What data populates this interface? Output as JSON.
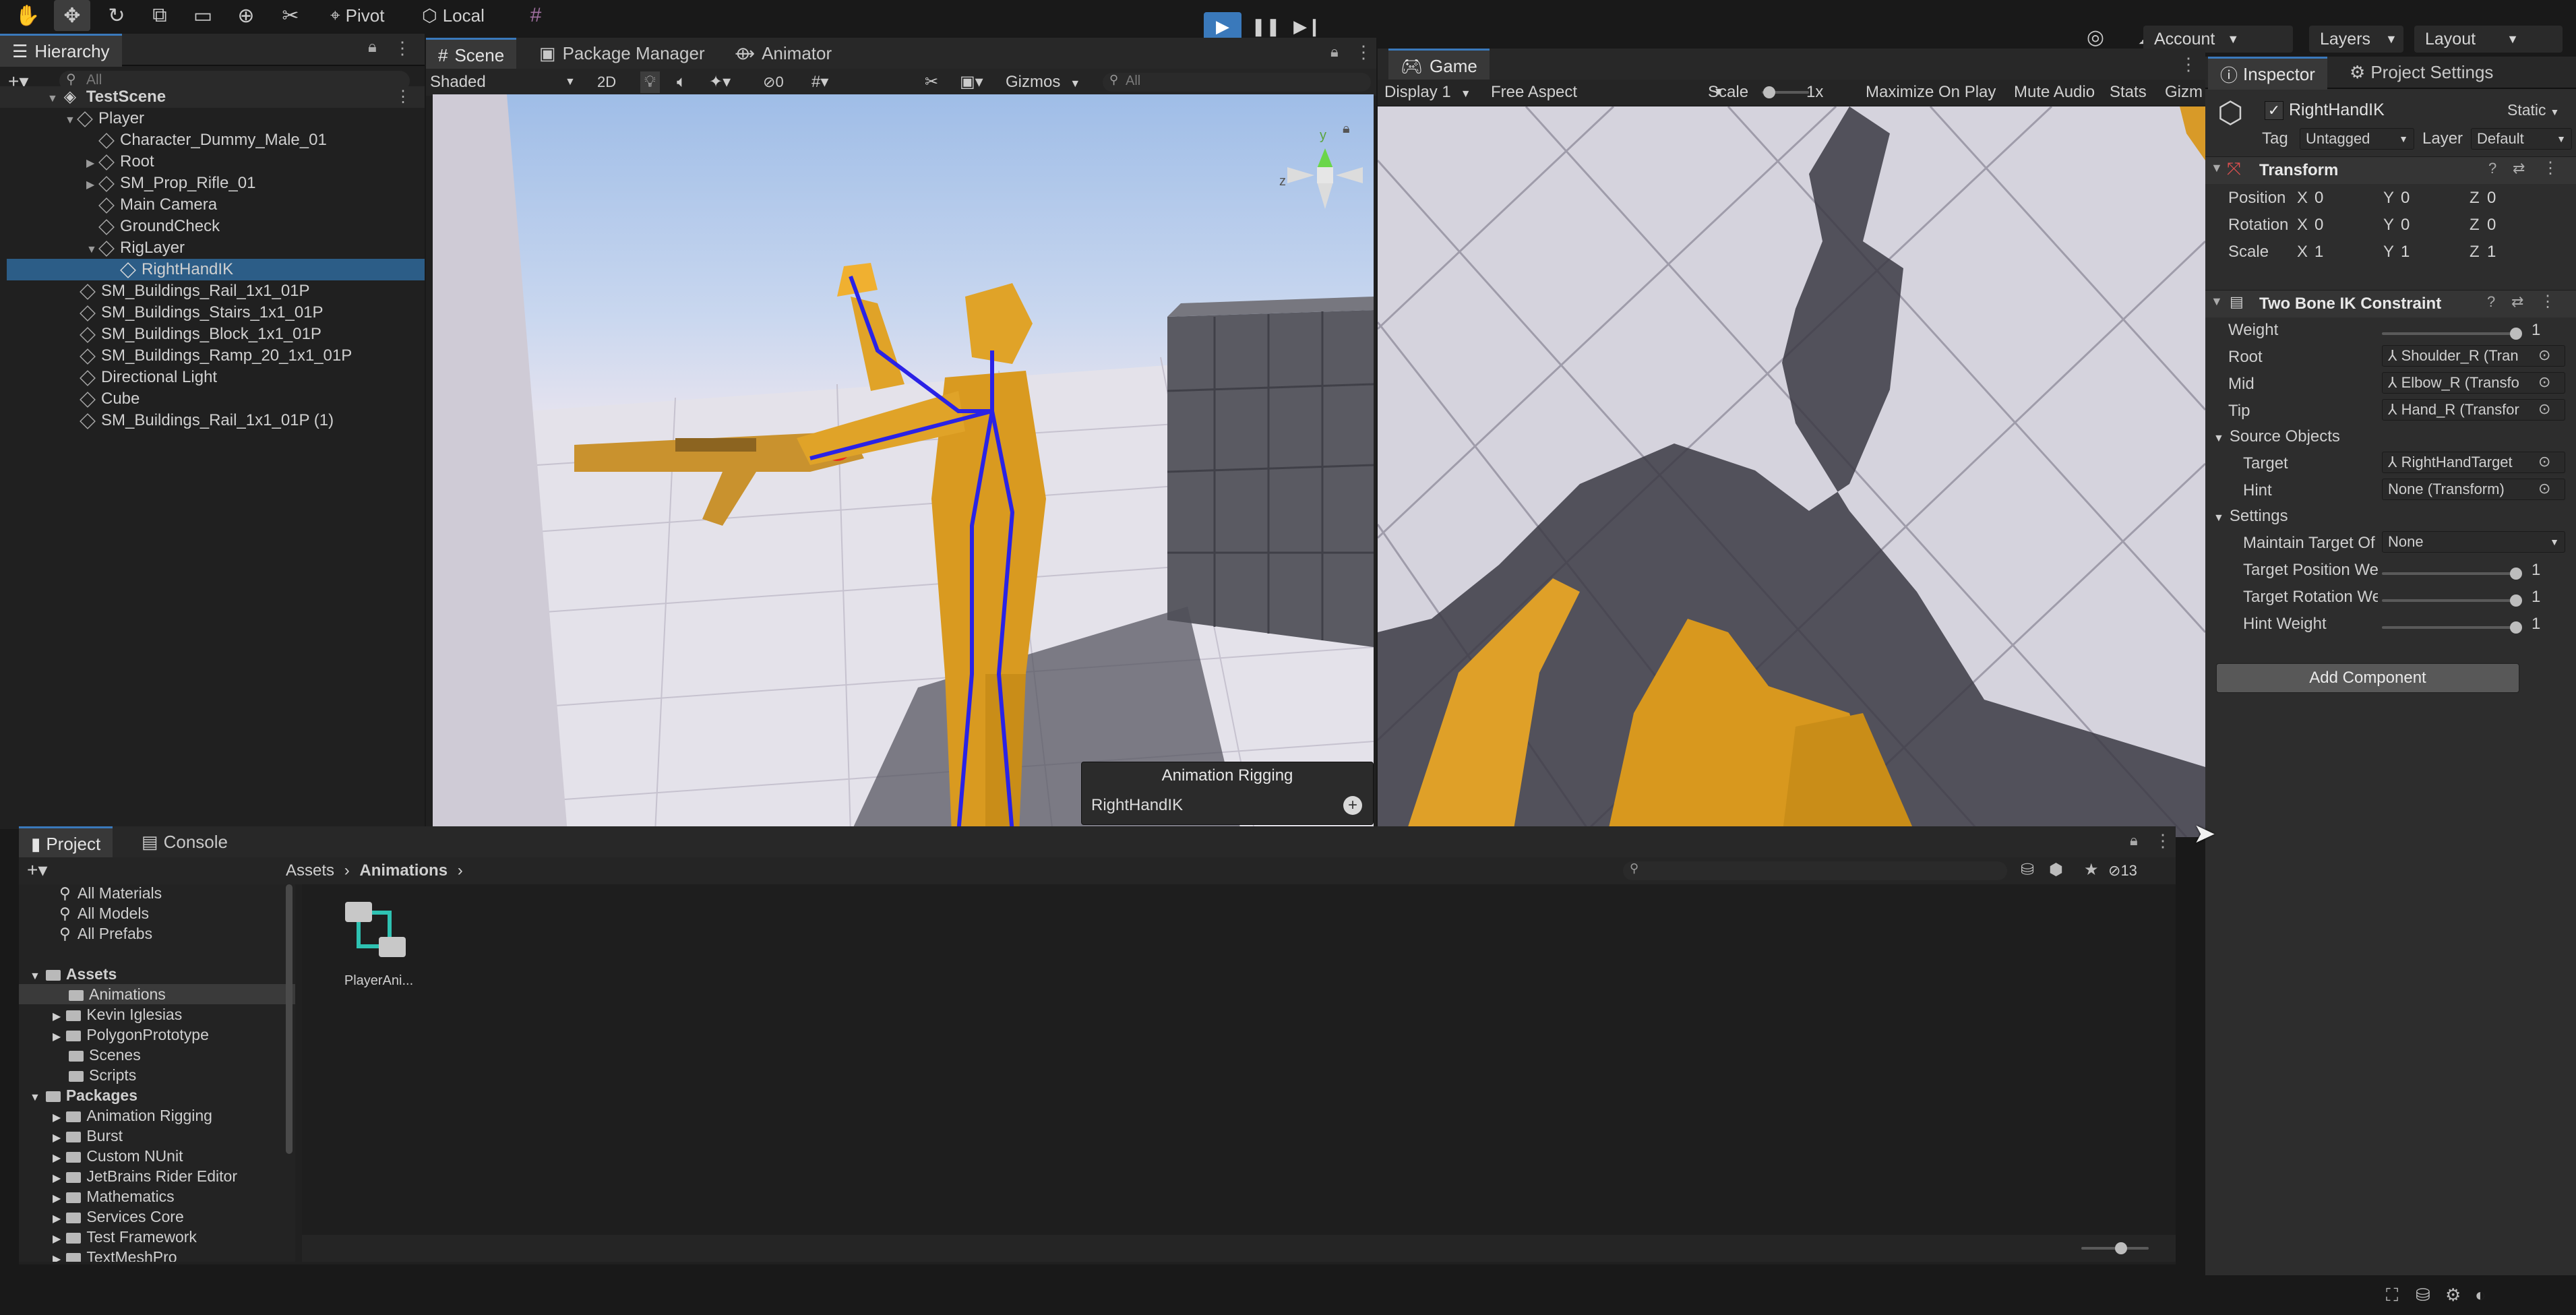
{
  "toolbar": {
    "pivot": "Pivot",
    "local": "Local",
    "account": "Account",
    "layers": "Layers",
    "layout": "Layout"
  },
  "hierarchy": {
    "tab": "Hierarchy",
    "search_placeholder": "All",
    "scene": "TestScene",
    "items": [
      {
        "label": "Player"
      },
      {
        "label": "Character_Dummy_Male_01"
      },
      {
        "label": "Root"
      },
      {
        "label": "SM_Prop_Rifle_01"
      },
      {
        "label": "Main Camera"
      },
      {
        "label": "GroundCheck"
      },
      {
        "label": "RigLayer"
      },
      {
        "label": "RightHandIK"
      },
      {
        "label": "SM_Buildings_Rail_1x1_01P"
      },
      {
        "label": "SM_Buildings_Stairs_1x1_01P"
      },
      {
        "label": "SM_Buildings_Block_1x1_01P"
      },
      {
        "label": "SM_Buildings_Ramp_20_1x1_01P"
      },
      {
        "label": "Directional Light"
      },
      {
        "label": "Cube"
      },
      {
        "label": "SM_Buildings_Rail_1x1_01P (1)"
      }
    ]
  },
  "scene": {
    "tabs": [
      "Scene",
      "Package Manager",
      "Animator"
    ],
    "shading": "Shaded",
    "mode_2d": "2D",
    "hidden_count": "0",
    "gizmos": "Gizmos",
    "search_placeholder": "All",
    "overlay_title": "Animation Rigging",
    "overlay_item": "RightHandIK"
  },
  "game": {
    "tab": "Game",
    "display": "Display 1",
    "aspect": "Free Aspect",
    "scale_label": "Scale",
    "scale_value": "1x",
    "maximize": "Maximize On Play",
    "mute": "Mute Audio",
    "stats": "Stats",
    "gizmos": "Gizm"
  },
  "inspector": {
    "tabs": [
      "Inspector",
      "Project Settings"
    ],
    "object_name": "RightHandIK",
    "static": "Static",
    "tag_label": "Tag",
    "tag_value": "Untagged",
    "layer_label": "Layer",
    "layer_value": "Default",
    "transform": {
      "title": "Transform",
      "rows": [
        {
          "label": "Position",
          "x": "0",
          "y": "0",
          "z": "0"
        },
        {
          "label": "Rotation",
          "x": "0",
          "y": "0",
          "z": "0"
        },
        {
          "label": "Scale",
          "x": "1",
          "y": "1",
          "z": "1"
        }
      ]
    },
    "ik": {
      "title": "Two Bone IK Constraint",
      "weight_label": "Weight",
      "weight_value": "1",
      "weight_level": 1.0,
      "root_label": "Root",
      "root_value": "Shoulder_R (Tran",
      "mid_label": "Mid",
      "mid_value": "Elbow_R (Transfo",
      "tip_label": "Tip",
      "tip_value": "Hand_R (Transfor",
      "source_objects": "Source Objects",
      "target_label": "Target",
      "target_value": "RightHandTarget",
      "hint_label": "Hint",
      "hint_value": "None (Transform)",
      "settings": "Settings",
      "maintain_label": "Maintain Target Of",
      "maintain_value": "None",
      "tpos_label": "Target Position We",
      "tpos_value": "1",
      "trot_label": "Target Rotation We",
      "trot_value": "1",
      "hint_weight_label": "Hint Weight",
      "hint_weight_value": "1"
    },
    "add_component": "Add Component"
  },
  "project": {
    "tabs": [
      "Project",
      "Console"
    ],
    "breadcrumb": [
      "Assets",
      "Animations"
    ],
    "hidden_count": "13",
    "favorites": [
      "All Materials",
      "All Models",
      "All Prefabs"
    ],
    "assets_root": "Assets",
    "assets": [
      "Animations",
      "Kevin Iglesias",
      "PolygonPrototype",
      "Scenes",
      "Scripts"
    ],
    "packages_root": "Packages",
    "packages": [
      "Animation Rigging",
      "Burst",
      "Custom NUnit",
      "JetBrains Rider Editor",
      "Mathematics",
      "Services Core",
      "Test Framework",
      "TextMeshPro"
    ],
    "file_label": "PlayerAni..."
  },
  "colors": {
    "accent": "#3a79bb",
    "selection": "#2c5d87",
    "character": "#e0a328",
    "bone": "#2a22e6"
  }
}
